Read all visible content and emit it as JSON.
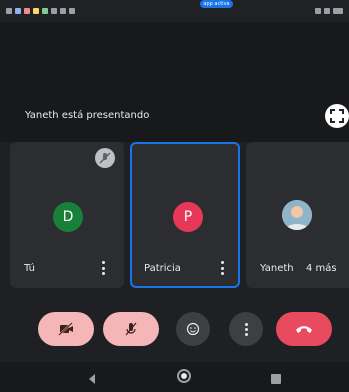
{
  "status_bar": {
    "top_pill_label": "app activa"
  },
  "presentation": {
    "presenting_text": "Yaneth está presentando"
  },
  "tiles": [
    {
      "name": "Tú",
      "initial": "D",
      "avatar_color": "#188038",
      "active": false
    },
    {
      "name": "Patricia",
      "initial": "P",
      "avatar_color": "#e8385a",
      "active": true
    },
    {
      "name": "Yaneth",
      "more_label": "4 más",
      "active": false
    }
  ],
  "controls": {
    "camera_icon": "camera-off-icon",
    "mic_icon": "mic-off-icon",
    "emoji_icon": "emoji-icon",
    "more_icon": "more-vert-icon",
    "hangup_icon": "end-call-icon"
  },
  "colors": {
    "active_border": "#1a73e8",
    "muted_button_bg": "#f4b6b6",
    "hangup_bg": "#e84a5f"
  },
  "nav": {
    "back_icon": "back-icon",
    "home_icon": "home-icon",
    "recents_icon": "recents-icon"
  }
}
